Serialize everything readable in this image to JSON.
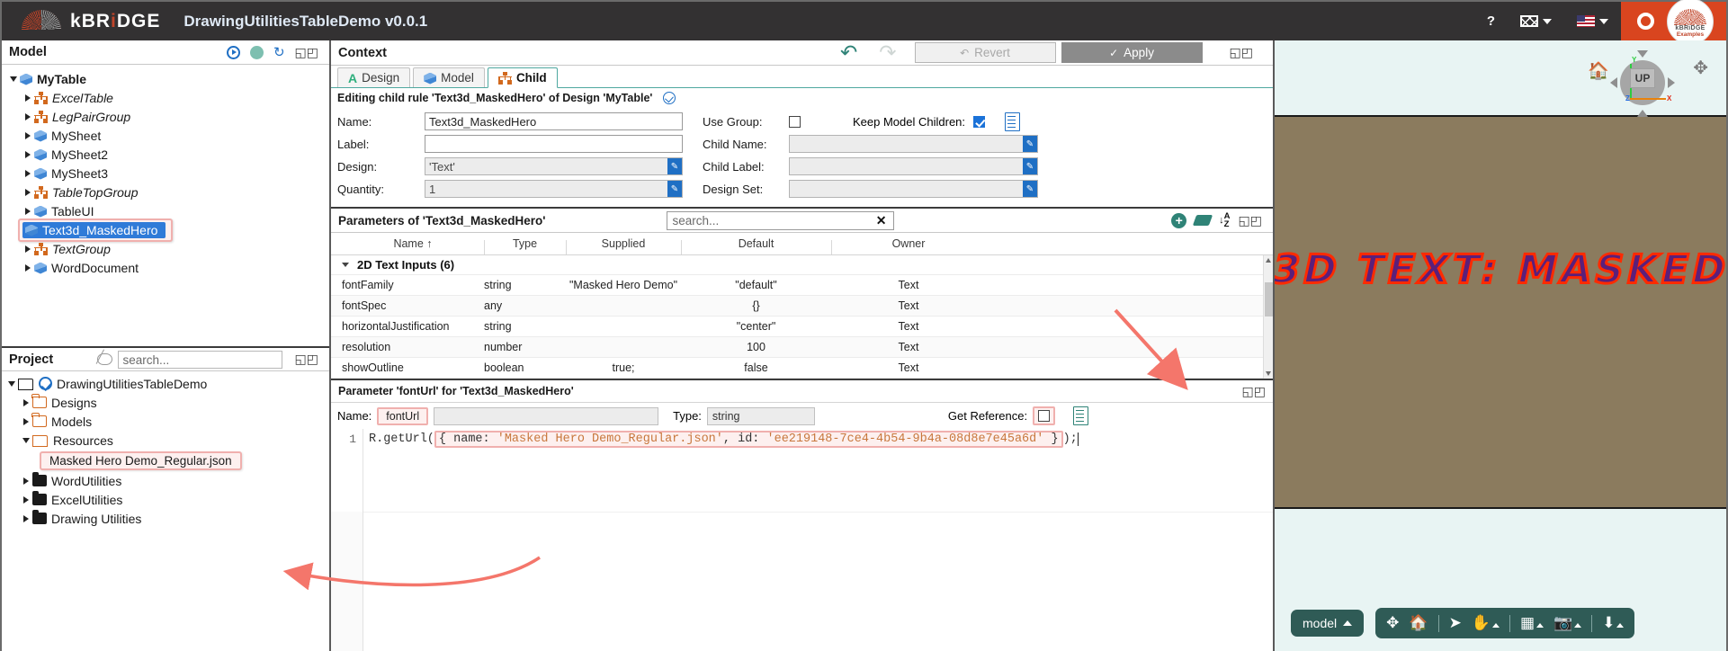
{
  "topbar": {
    "brand": "kBRiDGE",
    "brand_k": "k",
    "brand_b": "BR",
    "brand_i": "i",
    "brand_dge": "DGE",
    "app_title": "DrawingUtilitiesTableDemo v0.0.1",
    "help_label": "?",
    "mail_icon": "mail-icon",
    "locale_icon": "us-flag-icon",
    "gear_icon": "gear-icon",
    "badge_line1": "kBRiDGE",
    "badge_line2": "Examples"
  },
  "model_panel": {
    "title": "Model",
    "icons": [
      "play-icon",
      "status-dot-icon",
      "refresh-icon",
      "expand-icon"
    ],
    "tree": [
      {
        "label": "MyTable",
        "indent": 0,
        "icon": "cube",
        "twisty": "down",
        "italic": false,
        "selected": false
      },
      {
        "label": "ExcelTable",
        "indent": 1,
        "icon": "group",
        "twisty": "right",
        "italic": true,
        "selected": false
      },
      {
        "label": "LegPairGroup",
        "indent": 1,
        "icon": "group",
        "twisty": "right",
        "italic": true,
        "selected": false
      },
      {
        "label": "MySheet",
        "indent": 1,
        "icon": "cube",
        "twisty": "right",
        "italic": false,
        "selected": false
      },
      {
        "label": "MySheet2",
        "indent": 1,
        "icon": "cube",
        "twisty": "right",
        "italic": false,
        "selected": false
      },
      {
        "label": "MySheet3",
        "indent": 1,
        "icon": "cube",
        "twisty": "right",
        "italic": false,
        "selected": false
      },
      {
        "label": "TableTopGroup",
        "indent": 1,
        "icon": "group",
        "twisty": "right",
        "italic": true,
        "selected": false
      },
      {
        "label": "TableUI",
        "indent": 1,
        "icon": "cube",
        "twisty": "right",
        "italic": false,
        "selected": false
      },
      {
        "label": "Text3d_MaskedHero",
        "indent": 1,
        "icon": "cube",
        "twisty": "none",
        "italic": false,
        "selected": true
      },
      {
        "label": "TextGroup",
        "indent": 1,
        "icon": "group",
        "twisty": "right",
        "italic": true,
        "selected": false
      },
      {
        "label": "WordDocument",
        "indent": 1,
        "icon": "cube",
        "twisty": "right",
        "italic": false,
        "selected": false
      }
    ]
  },
  "project_panel": {
    "title": "Project",
    "search_placeholder": "search...",
    "eye_icon": "hidden-eye-icon",
    "expand_icon": "expand-icon",
    "tree": [
      {
        "label": "DrawingUtilitiesTableDemo",
        "indent": 0,
        "icon": "folder-open-check",
        "twisty": "down",
        "highlight": false
      },
      {
        "label": "Designs",
        "indent": 1,
        "icon": "folder-outline",
        "twisty": "right",
        "highlight": false
      },
      {
        "label": "Models",
        "indent": 1,
        "icon": "folder-outline",
        "twisty": "right",
        "highlight": false
      },
      {
        "label": "Resources",
        "indent": 1,
        "icon": "folder-open",
        "twisty": "down",
        "highlight": false
      },
      {
        "label": "Masked Hero Demo_Regular.json",
        "indent": 2,
        "icon": "none",
        "twisty": "none",
        "highlight": true
      },
      {
        "label": "WordUtilities",
        "indent": 1,
        "icon": "folder-filled",
        "twisty": "right",
        "highlight": false
      },
      {
        "label": "ExcelUtilities",
        "indent": 1,
        "icon": "folder-filled",
        "twisty": "right",
        "highlight": false
      },
      {
        "label": "Drawing Utilities",
        "indent": 1,
        "icon": "folder-filled",
        "twisty": "right",
        "highlight": false
      }
    ]
  },
  "context": {
    "title": "Context",
    "undo_icon": "undo-icon",
    "redo_icon": "redo-icon",
    "revert_label": "Revert",
    "apply_label": "Apply",
    "expand_icon": "expand-icon",
    "tabs": [
      {
        "label": "Design",
        "icon": "design-a-icon",
        "active": false
      },
      {
        "label": "Model",
        "icon": "cube-icon",
        "active": false
      },
      {
        "label": "Child",
        "icon": "group-icon",
        "active": true
      }
    ],
    "editing_line": "Editing child rule 'Text3d_MaskedHero' of Design 'MyTable'",
    "editing_check_icon": "valid-check-icon",
    "form": {
      "name_label": "Name:",
      "name_value": "Text3d_MaskedHero",
      "label_label": "Label:",
      "label_value": "",
      "design_label": "Design:",
      "design_value": "'Text'",
      "quantity_label": "Quantity:",
      "quantity_value": "1",
      "use_group_label": "Use Group:",
      "use_group_checked": false,
      "keep_model_children_label": "Keep Model Children:",
      "keep_model_children_checked": true,
      "child_name_label": "Child Name:",
      "child_name_value": "",
      "child_label_label": "Child Label:",
      "child_label_value": "",
      "design_set_label": "Design Set:",
      "design_set_value": "",
      "doc_icon": "document-icon"
    }
  },
  "parameters": {
    "title": "Parameters of 'Text3d_MaskedHero'",
    "search_placeholder": "search...",
    "clear_icon": "clear-x-icon",
    "add_icon": "add-circle-icon",
    "erase_icon": "eraser-icon",
    "sort_icon": "sort-az-icon",
    "expand_icon": "expand-icon",
    "columns": [
      "Name",
      "Type",
      "Supplied",
      "Default",
      "Owner"
    ],
    "sort_column": "Name",
    "sort_dir": "asc",
    "group_row": "2D Text Inputs (6)",
    "rows": [
      {
        "name": "fontFamily",
        "type": "string",
        "supplied": "\"Masked Hero Demo\"",
        "default": "\"default\"",
        "owner": "Text"
      },
      {
        "name": "fontSpec",
        "type": "any",
        "supplied": "",
        "default": "{}",
        "owner": "Text"
      },
      {
        "name": "horizontalJustification",
        "type": "string",
        "supplied": "",
        "default": "\"center\"",
        "owner": "Text"
      },
      {
        "name": "resolution",
        "type": "number",
        "supplied": "",
        "default": "100",
        "owner": "Text"
      },
      {
        "name": "showOutline",
        "type": "boolean",
        "supplied": "true;",
        "default": "false",
        "owner": "Text"
      }
    ]
  },
  "param_editor": {
    "title": "Parameter 'fontUrl' for 'Text3d_MaskedHero'",
    "expand_icon": "expand-icon",
    "name_label": "Name:",
    "name_value": "fontUrl",
    "type_label": "Type:",
    "type_value": "string",
    "get_reference_label": "Get Reference:",
    "get_reference_checked": false,
    "doc_icon": "document-icon",
    "code_line_number": "1",
    "code_prefix": "R.getUrl(",
    "code_brace_open": "{ ",
    "code_key_name": "name: ",
    "code_val_name": "'Masked Hero Demo_Regular.json'",
    "code_comma": ", ",
    "code_key_id": "id: ",
    "code_val_id": "'ee219148-7ce4-4b54-9b4a-08d8e7e45a6d'",
    "code_brace_close": " }",
    "code_suffix": ");"
  },
  "viewport": {
    "hero_text": "3D TEXT: MASKED",
    "nav_cube_label": "UP",
    "axis_y": "Y",
    "axis_x": "X",
    "axis_z": "Z",
    "home_icon": "home-icon",
    "pan-icon": "pan-arrows-icon",
    "model_button": "model",
    "toolbar_icons": [
      "fit-icon",
      "home-icon",
      "select-arrow-icon",
      "pan-hand-icon",
      "box-icon",
      "camera-icon",
      "download-icon"
    ],
    "colors": {
      "sky": "#e8f4f3",
      "ground": "#8b7b5e",
      "text_fill": "#5b1f7a",
      "text_outline": "#ff2a00"
    }
  }
}
